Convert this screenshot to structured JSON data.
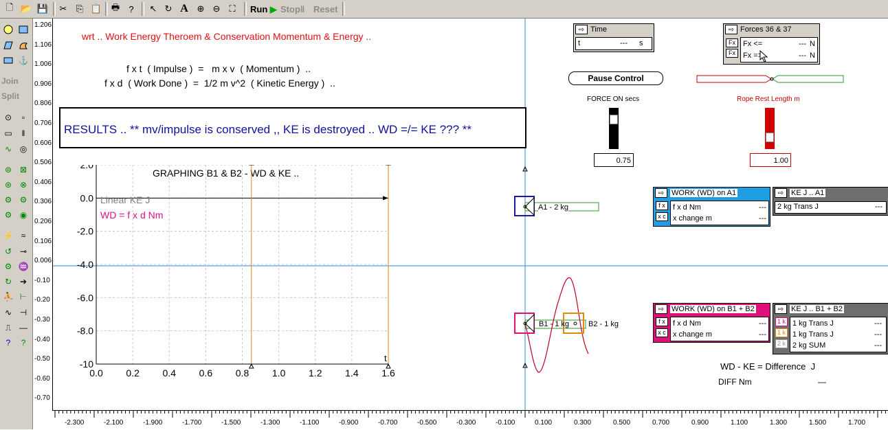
{
  "toolbar": {
    "run_label": "Run",
    "stop_label": "Stop",
    "reset_label": "Reset"
  },
  "palette": {
    "join_label": "Join",
    "split_label": "Split"
  },
  "vruler": [
    "1.206",
    "1.106",
    "1.006",
    "0.906",
    "0.806",
    "0.706",
    "0.606",
    "0.506",
    "0.406",
    "0.306",
    "0.206",
    "0.106",
    "0.006",
    "-0.10",
    "-0.20",
    "-0.30",
    "-0.40",
    "-0.50",
    "-0.60",
    "-0.70"
  ],
  "hruler": [
    "-2.300",
    "-2.100",
    "-1.900",
    "-1.700",
    "-1.500",
    "-1.300",
    "-1.100",
    "-0.900",
    "-0.700",
    "-0.500",
    "-0.300",
    "-0.100",
    "0.100",
    "0.300",
    "0.500",
    "0.700",
    "0.900",
    "1.100",
    "1.300",
    "1.500",
    "1.700"
  ],
  "canvas": {
    "title": "wrt .. Work Energy Theroem & Conservation Momentum & Energy ..",
    "eq1": "f x t  ( Impulse )  =   m x v  ( Momentum )  ..",
    "eq2": "f x d  ( Work Done )  =  1/2 m v^2  ( Kinetic Energy )  ..",
    "results": "RESULTS .. ** mv/impulse is conserved ,, KE is destroyed .. WD =/= KE ??? **",
    "graph_title": "GRAPHING B1 & B2 - WD & KE ..",
    "legend_ke": "Linear KE J",
    "legend_wd": "WD = f x d Nm",
    "a1_label": "A1 - 2 kg",
    "b1_label": "B1 - 1 kg",
    "b2_label": "B2 - 1 kg",
    "wdke_label": "WD - KE = Difference  J",
    "diff_label": "DIFF Nm",
    "diff_value": "—"
  },
  "chart_data": {
    "type": "line",
    "title": "GRAPHING B1 & B2 - WD & KE ..",
    "x_ticks": [
      "0.0",
      "0.2",
      "0.4",
      "0.6",
      "0.8",
      "1.0",
      "1.2",
      "1.4",
      "1.6"
    ],
    "y_ticks": [
      "2.0",
      "0.0",
      "-2.0",
      "-4.0",
      "-6.0",
      "-8.0",
      "-10"
    ],
    "xlabel": "t",
    "xlim": [
      0,
      1.6
    ],
    "ylim": [
      -10,
      2
    ],
    "series": [
      {
        "name": "Linear KE J",
        "color": "#808080",
        "x": [],
        "y": []
      },
      {
        "name": "WD = f x d Nm",
        "color": "#e0108a",
        "x": [],
        "y": []
      }
    ]
  },
  "time_panel": {
    "title": "Time",
    "var": "t",
    "value": "---",
    "unit": "s"
  },
  "forces_panel": {
    "title": "Forces 36 & 37",
    "rows": [
      {
        "tag": "Fx",
        "label": "Fx <=",
        "value": "---",
        "unit": "N"
      },
      {
        "tag": "Fx",
        "label": "Fx =>",
        "value": "---",
        "unit": "N"
      }
    ]
  },
  "pause_button": "Pause Control",
  "force_on": {
    "label": "FORCE ON secs",
    "value": "0.75"
  },
  "rope_rest": {
    "label": "Rope Rest Length m",
    "value": "1.00"
  },
  "work_a1": {
    "title": "WORK (WD) on A1",
    "rows": [
      {
        "tag": "f x",
        "label": "f x d Nm",
        "value": "---"
      },
      {
        "tag": "x c",
        "label": "x change m",
        "value": "---"
      }
    ]
  },
  "ke_a1": {
    "title": "KE J .. A1",
    "rows": [
      {
        "label": "2 kg Trans J",
        "value": "---"
      }
    ]
  },
  "work_b": {
    "title": "WORK (WD) on B1 + B2",
    "rows": [
      {
        "tag": "f x",
        "label": "f x d Nm",
        "value": "---"
      },
      {
        "tag": "x c",
        "label": "x change m",
        "value": "---"
      }
    ]
  },
  "ke_b": {
    "title": "KE J .. B1 + B2",
    "rows": [
      {
        "tag": "1 k",
        "label": "1 kg Trans J",
        "value": "---"
      },
      {
        "tag": "1 k",
        "label": "1 kg Trans J",
        "value": "---"
      },
      {
        "tag": "2 k",
        "label": "2 kg SUM",
        "value": "---"
      }
    ]
  },
  "colors": {
    "title_red": "#e01010",
    "results_blue": "#1010a0",
    "work_a1": "#1e9ee0",
    "work_b": "#e0107a",
    "ke_header": "#6e6e6e",
    "axis_blue": "#2a8ad8",
    "orange": "#e08a10",
    "rope_red": "#c00000"
  }
}
